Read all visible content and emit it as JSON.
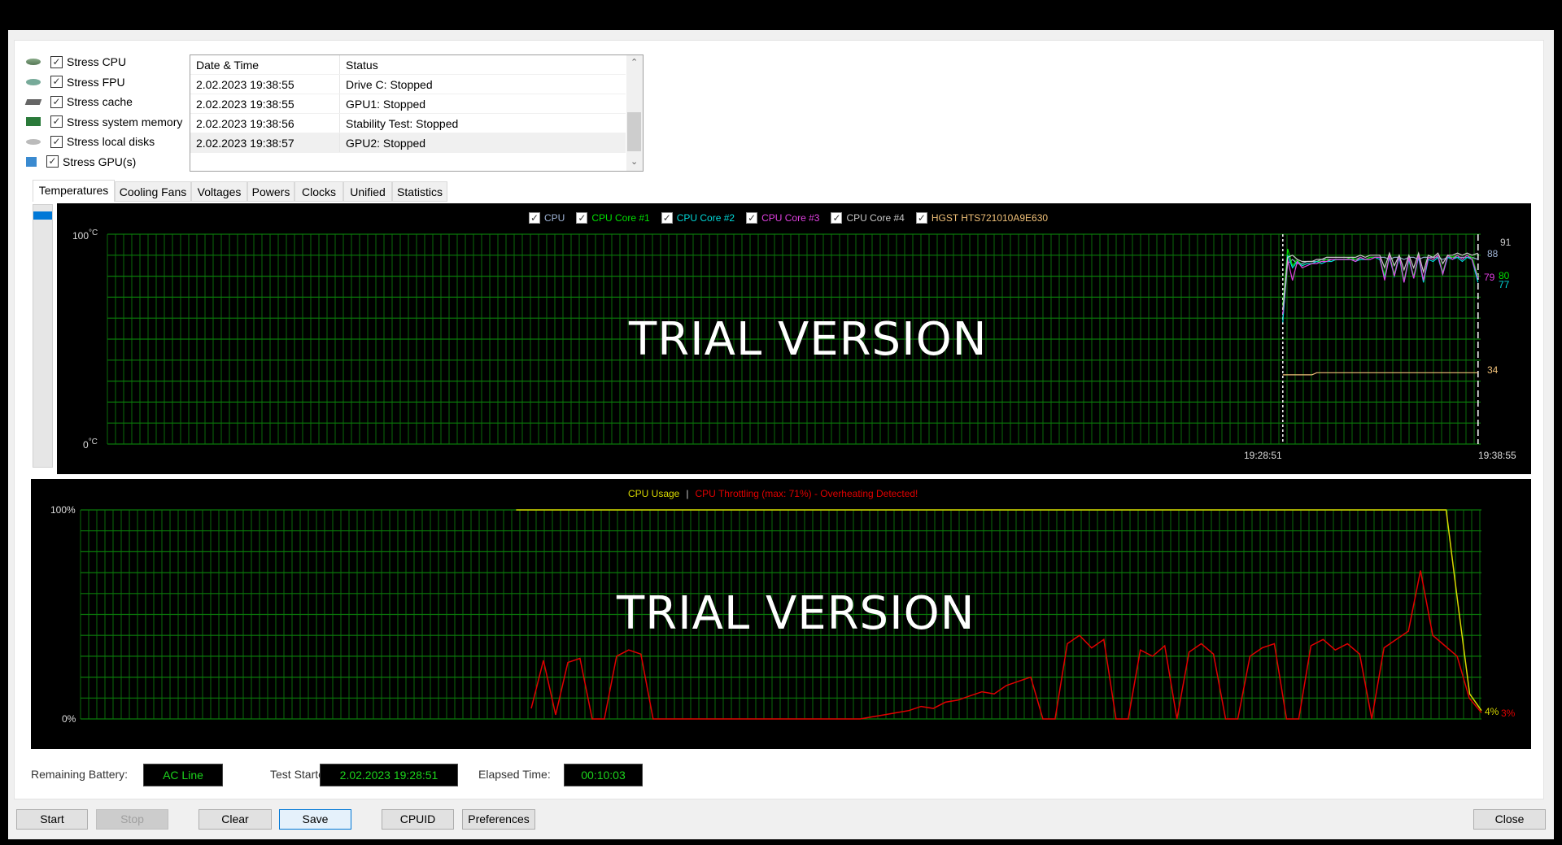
{
  "stress_options": [
    {
      "label": "Stress CPU",
      "checked": true,
      "icon": "cpu-icon"
    },
    {
      "label": "Stress FPU",
      "checked": true,
      "icon": "fpu-icon"
    },
    {
      "label": "Stress cache",
      "checked": true,
      "icon": "cache-icon"
    },
    {
      "label": "Stress system memory",
      "checked": true,
      "icon": "memory-icon"
    },
    {
      "label": "Stress local disks",
      "checked": true,
      "icon": "disk-icon"
    },
    {
      "label": "Stress GPU(s)",
      "checked": true,
      "icon": "gpu-icon"
    }
  ],
  "log": {
    "columns": [
      "Date & Time",
      "Status"
    ],
    "rows": [
      [
        "2.02.2023 19:38:55",
        "Drive C: Stopped"
      ],
      [
        "2.02.2023 19:38:55",
        "GPU1: Stopped"
      ],
      [
        "2.02.2023 19:38:56",
        "Stability Test: Stopped"
      ],
      [
        "2.02.2023 19:38:57",
        "GPU2: Stopped"
      ]
    ]
  },
  "tabs": [
    "Temperatures",
    "Cooling Fans",
    "Voltages",
    "Powers",
    "Clocks",
    "Unified",
    "Statistics"
  ],
  "active_tab": "Temperatures",
  "watermark": "TRIAL VERSION",
  "chart_data": [
    {
      "type": "line",
      "ylim": [
        0,
        100
      ],
      "y_top_label": "100",
      "y_bottom_label": "0",
      "y_unit": "°C",
      "x_tick_labels": [
        "19:28:51",
        "19:38:55"
      ],
      "xlim": [
        "18:28:15",
        "19:39:03"
      ],
      "grid": true,
      "legend_placement": "top-center",
      "markers": [
        "19:28:51",
        "19:38:55"
      ],
      "x": [
        "19:28:51",
        "19:29:06",
        "19:29:21",
        "19:29:36",
        "19:29:51",
        "19:30:06",
        "19:30:21",
        "19:30:36",
        "19:30:51",
        "19:31:06",
        "19:31:21",
        "19:31:36",
        "19:31:51",
        "19:32:06",
        "19:32:21",
        "19:32:36",
        "19:32:51",
        "19:33:06",
        "19:33:21",
        "19:33:36",
        "19:33:51",
        "19:34:06",
        "19:34:21",
        "19:34:36",
        "19:34:51",
        "19:35:06",
        "19:35:21",
        "19:35:36",
        "19:35:51",
        "19:36:06",
        "19:36:21",
        "19:36:36",
        "19:36:51",
        "19:37:06",
        "19:37:21",
        "19:37:36",
        "19:37:51",
        "19:38:06",
        "19:38:21",
        "19:38:36",
        "19:38:55"
      ],
      "series": [
        {
          "name": "CPU",
          "color": "#8fa6c8",
          "checked": true,
          "last": "88",
          "values": [
            60,
            86,
            88,
            86,
            86,
            87,
            87,
            87,
            88,
            88,
            88,
            88,
            88,
            88,
            88,
            88,
            89,
            88,
            89,
            89,
            89,
            89,
            88,
            89,
            89,
            88,
            89,
            89,
            88,
            89,
            89,
            89,
            89,
            88,
            89,
            89,
            89,
            89,
            89,
            89,
            88
          ]
        },
        {
          "name": "CPU Core #1",
          "color": "#00e000",
          "checked": true,
          "last": "80",
          "values": [
            66,
            93,
            85,
            88,
            85,
            86,
            86,
            87,
            87,
            88,
            87,
            88,
            88,
            88,
            89,
            88,
            88,
            88,
            89,
            89,
            89,
            80,
            90,
            81,
            90,
            78,
            89,
            80,
            90,
            78,
            89,
            88,
            90,
            82,
            90,
            89,
            90,
            88,
            90,
            89,
            80
          ]
        },
        {
          "name": "CPU Core #2",
          "color": "#00d8d8",
          "checked": true,
          "last": "77",
          "values": [
            58,
            90,
            84,
            87,
            85,
            86,
            86,
            87,
            86,
            87,
            87,
            88,
            88,
            88,
            88,
            87,
            88,
            88,
            88,
            89,
            88,
            79,
            89,
            80,
            89,
            77,
            88,
            79,
            89,
            77,
            88,
            87,
            89,
            81,
            89,
            88,
            89,
            87,
            89,
            88,
            77
          ]
        },
        {
          "name": "CPU Core #3",
          "color": "#e040e0",
          "checked": true,
          "last": "79",
          "values": [
            62,
            88,
            78,
            87,
            84,
            85,
            86,
            86,
            87,
            87,
            88,
            88,
            88,
            88,
            88,
            87,
            89,
            88,
            88,
            89,
            89,
            78,
            90,
            80,
            90,
            77,
            89,
            79,
            90,
            78,
            89,
            88,
            90,
            81,
            90,
            88,
            90,
            88,
            90,
            88,
            79
          ]
        },
        {
          "name": "CPU Core #4",
          "color": "#c8c8c8",
          "checked": true,
          "last": "91",
          "values": [
            64,
            89,
            90,
            88,
            87,
            87,
            87,
            88,
            88,
            89,
            89,
            89,
            89,
            89,
            89,
            89,
            90,
            89,
            90,
            90,
            90,
            84,
            91,
            85,
            90,
            83,
            90,
            84,
            91,
            82,
            90,
            89,
            91,
            86,
            90,
            90,
            91,
            90,
            91,
            90,
            91
          ]
        },
        {
          "name": "HGST HTS721010A9E630",
          "color": "#f0c078",
          "checked": true,
          "last": "34",
          "values": [
            33,
            33,
            33,
            33,
            33,
            33,
            33,
            34,
            34,
            34,
            34,
            34,
            34,
            34,
            34,
            34,
            34,
            34,
            34,
            34,
            34,
            34,
            34,
            34,
            34,
            34,
            34,
            34,
            34,
            34,
            34,
            34,
            34,
            34,
            34,
            34,
            34,
            34,
            34,
            34,
            34
          ]
        }
      ]
    },
    {
      "type": "line",
      "ylim": [
        0,
        100
      ],
      "y_top_label": "100%",
      "y_bottom_label": "0%",
      "grid": true,
      "legend_placement": "top-center",
      "legend_separator": "|",
      "series": [
        {
          "name": "CPU Usage",
          "color": "#d8d800",
          "last": "4%",
          "values": [
            null,
            null,
            null,
            null,
            null,
            null,
            null,
            null,
            null,
            null,
            null,
            null,
            null,
            null,
            null,
            null,
            null,
            null,
            null,
            null,
            null,
            null,
            null,
            null,
            null,
            null,
            null,
            null,
            null,
            null,
            null,
            null,
            null,
            null,
            null,
            null,
            null,
            100,
            100,
            100,
            100,
            100,
            100,
            100,
            100,
            100,
            100,
            100,
            100,
            100,
            100,
            100,
            100,
            100,
            100,
            100,
            100,
            100,
            100,
            100,
            100,
            100,
            100,
            100,
            100,
            100,
            100,
            100,
            100,
            100,
            100,
            100,
            100,
            100,
            100,
            100,
            100,
            100,
            100,
            100,
            100,
            100,
            100,
            100,
            100,
            100,
            100,
            100,
            100,
            100,
            100,
            100,
            100,
            100,
            100,
            100,
            100,
            100,
            100,
            100,
            100,
            100,
            100,
            100,
            100,
            100,
            100,
            100,
            100,
            100,
            100,
            100,
            100,
            100,
            100,
            100,
            100,
            55,
            12,
            4
          ]
        },
        {
          "name": "CPU Throttling (max: 71%) - Overheating Detected!",
          "color": "#e00000",
          "last": "3%",
          "values": [
            null,
            null,
            null,
            null,
            null,
            null,
            null,
            null,
            null,
            null,
            null,
            null,
            null,
            null,
            null,
            null,
            null,
            null,
            null,
            null,
            null,
            null,
            null,
            null,
            null,
            null,
            null,
            null,
            null,
            null,
            null,
            null,
            null,
            null,
            null,
            null,
            null,
            5,
            28,
            2,
            27,
            29,
            0,
            0,
            30,
            33,
            31,
            0,
            0,
            0,
            0,
            0,
            0,
            0,
            0,
            0,
            0,
            0,
            0,
            0,
            0,
            0,
            0,
            0,
            0,
            1,
            2,
            3,
            4,
            6,
            5,
            8,
            9,
            11,
            13,
            12,
            16,
            18,
            20,
            0,
            0,
            36,
            40,
            34,
            38,
            0,
            0,
            33,
            30,
            35,
            0,
            32,
            36,
            31,
            0,
            0,
            30,
            34,
            36,
            0,
            0,
            35,
            38,
            33,
            36,
            31,
            0,
            34,
            38,
            42,
            71,
            40,
            35,
            30,
            10,
            3
          ]
        }
      ]
    }
  ],
  "status": {
    "battery_label": "Remaining Battery:",
    "battery_value": "AC Line",
    "started_label": "Test Started:",
    "started_value": "2.02.2023 19:28:51",
    "elapsed_label": "Elapsed Time:",
    "elapsed_value": "00:10:03"
  },
  "buttons": {
    "start": "Start",
    "stop": "Stop",
    "clear": "Clear",
    "save": "Save",
    "cpuid": "CPUID",
    "preferences": "Preferences",
    "close": "Close"
  }
}
